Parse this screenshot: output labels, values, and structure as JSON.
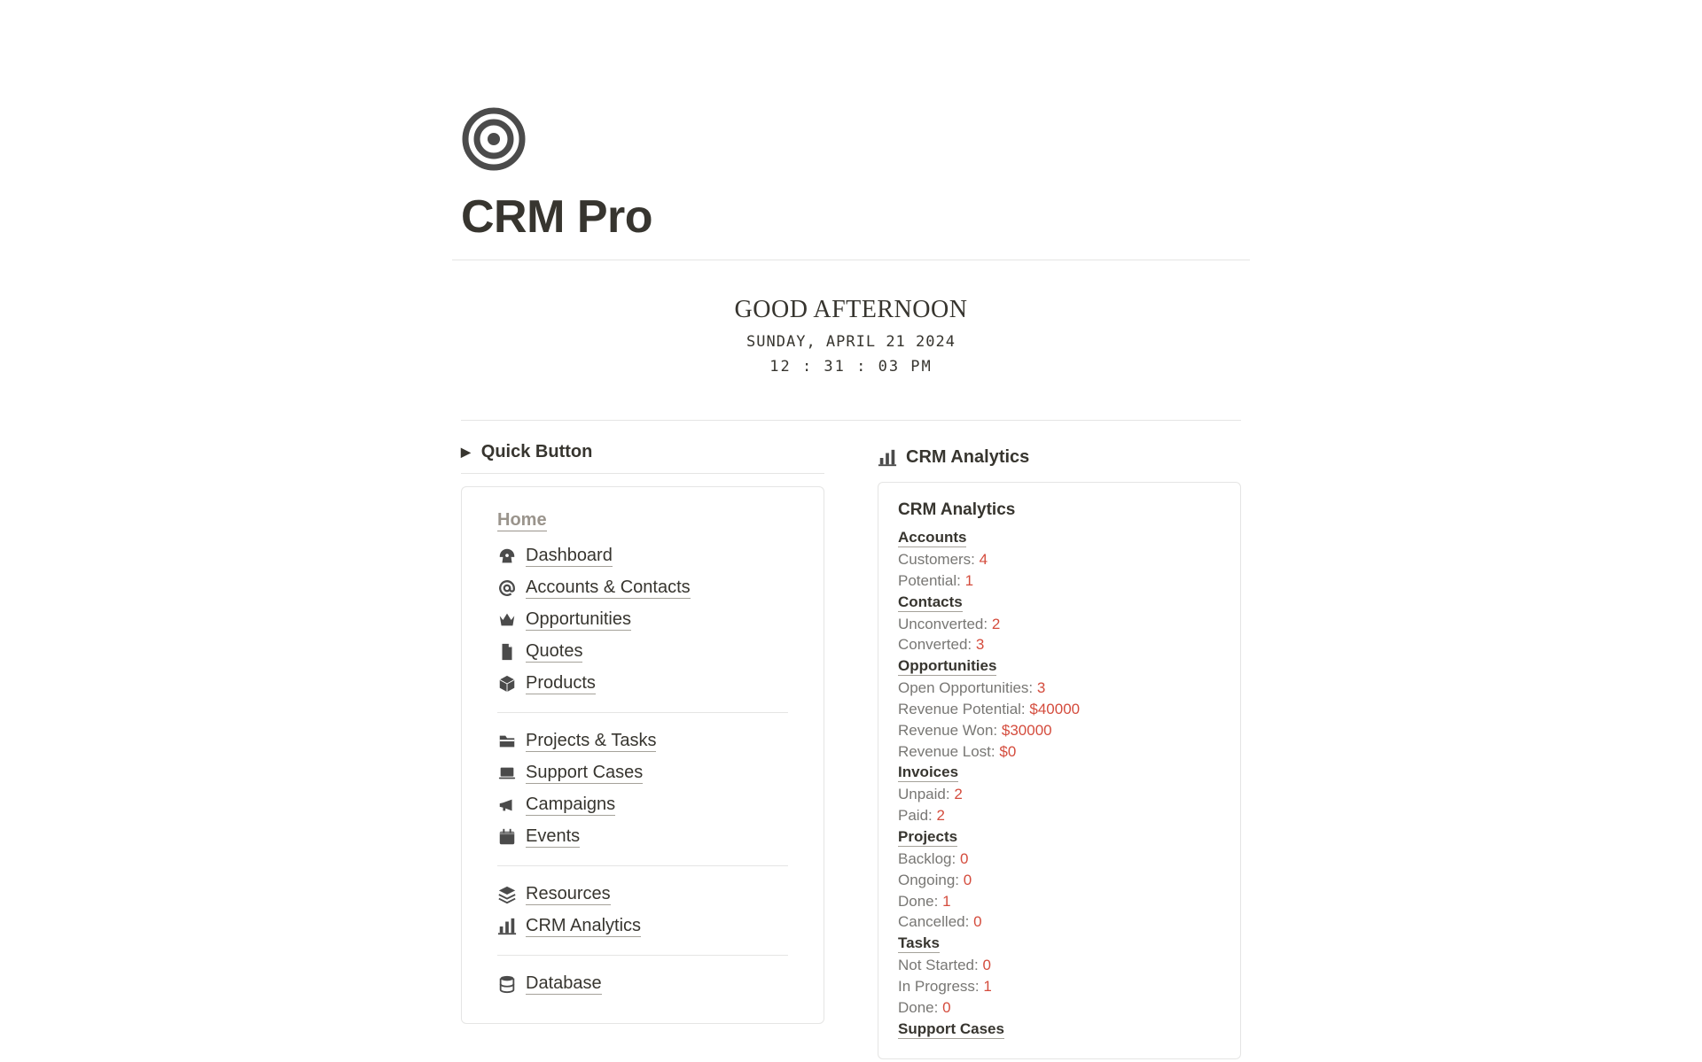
{
  "page": {
    "title": "CRM Pro",
    "greeting": "GOOD AFTERNOON",
    "date": "SUNDAY, APRIL 21 2024",
    "time": "12 : 31 : 03 PM"
  },
  "sidebar": {
    "quick_button": "Quick Button",
    "home": "Home",
    "groups": [
      {
        "items": [
          {
            "icon": "gauge",
            "label": "Dashboard"
          },
          {
            "icon": "at",
            "label": "Accounts & Contacts"
          },
          {
            "icon": "crown",
            "label": "Opportunities"
          },
          {
            "icon": "file",
            "label": "Quotes"
          },
          {
            "icon": "box",
            "label": "Products"
          }
        ]
      },
      {
        "items": [
          {
            "icon": "folder",
            "label": "Projects & Tasks"
          },
          {
            "icon": "laptop",
            "label": "Support Cases"
          },
          {
            "icon": "bullhorn",
            "label": "Campaigns"
          },
          {
            "icon": "calendar",
            "label": "Events"
          }
        ]
      },
      {
        "items": [
          {
            "icon": "layers",
            "label": "Resources"
          },
          {
            "icon": "chart",
            "label": "CRM Analytics"
          }
        ]
      },
      {
        "items": [
          {
            "icon": "database",
            "label": "Database"
          }
        ]
      }
    ]
  },
  "analytics": {
    "header": "CRM Analytics",
    "card_title": "CRM Analytics",
    "sections": [
      {
        "label": "Accounts",
        "metrics": [
          {
            "k": "Customers:",
            "v": "4"
          },
          {
            "k": "Potential:",
            "v": "1"
          }
        ]
      },
      {
        "label": "Contacts",
        "metrics": [
          {
            "k": "Unconverted:",
            "v": "2"
          },
          {
            "k": "Converted:",
            "v": "3"
          }
        ]
      },
      {
        "label": "Opportunities",
        "metrics": [
          {
            "k": "Open Opportunities:",
            "v": "3"
          },
          {
            "k": "Revenue Potential:",
            "v": "$40000"
          },
          {
            "k": "Revenue Won:",
            "v": "$30000"
          },
          {
            "k": "Revenue Lost:",
            "v": "$0"
          }
        ]
      },
      {
        "label": "Invoices",
        "metrics": [
          {
            "k": "Unpaid:",
            "v": "2"
          },
          {
            "k": "Paid:",
            "v": "2"
          }
        ]
      },
      {
        "label": "Projects",
        "metrics": [
          {
            "k": "Backlog:",
            "v": "0"
          },
          {
            "k": "Ongoing:",
            "v": "0"
          },
          {
            "k": "Done:",
            "v": "1"
          },
          {
            "k": "Cancelled:",
            "v": "0"
          }
        ]
      },
      {
        "label": "Tasks",
        "metrics": [
          {
            "k": "Not Started:",
            "v": "0"
          },
          {
            "k": "In Progress:",
            "v": "1"
          },
          {
            "k": "Done:",
            "v": "0"
          }
        ]
      },
      {
        "label": "Support Cases",
        "metrics": []
      }
    ]
  }
}
